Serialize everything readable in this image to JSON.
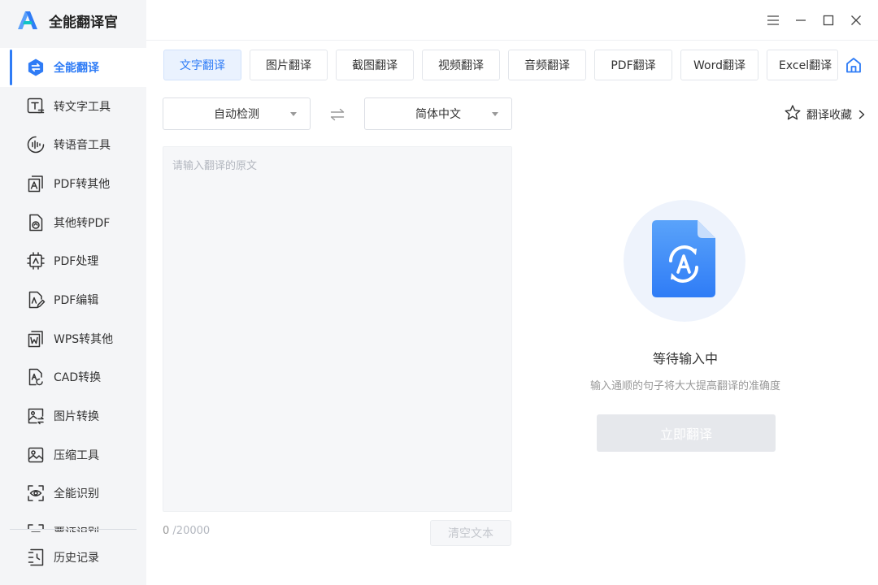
{
  "app": {
    "name": "全能翻译官"
  },
  "sidebar": {
    "items": [
      {
        "label": "全能翻译",
        "icon": "translate-icon",
        "active": true
      },
      {
        "label": "转文字工具",
        "icon": "text-tool-icon"
      },
      {
        "label": "转语音工具",
        "icon": "voice-tool-icon"
      },
      {
        "label": "PDF转其他",
        "icon": "pdf-convert-icon"
      },
      {
        "label": "其他转PDF",
        "icon": "to-pdf-icon"
      },
      {
        "label": "PDF处理",
        "icon": "pdf-process-icon"
      },
      {
        "label": "PDF编辑",
        "icon": "pdf-edit-icon"
      },
      {
        "label": "WPS转其他",
        "icon": "wps-convert-icon"
      },
      {
        "label": "CAD转换",
        "icon": "cad-convert-icon"
      },
      {
        "label": "图片转换",
        "icon": "image-convert-icon"
      },
      {
        "label": "压缩工具",
        "icon": "compress-icon"
      },
      {
        "label": "全能识别",
        "icon": "recognize-icon"
      },
      {
        "label": "票证识别",
        "icon": "ticket-icon"
      }
    ],
    "history_label": "历史记录"
  },
  "tabs": [
    {
      "label": "文字翻译",
      "active": true
    },
    {
      "label": "图片翻译"
    },
    {
      "label": "截图翻译"
    },
    {
      "label": "视频翻译"
    },
    {
      "label": "音频翻译"
    },
    {
      "label": "PDF翻译"
    },
    {
      "label": "Word翻译"
    },
    {
      "label": "Excel翻译"
    }
  ],
  "language": {
    "source": "自动检测",
    "target": "简体中文"
  },
  "favorites_label": "翻译收藏",
  "input": {
    "placeholder": "请输入翻译的原文",
    "char_count": "0",
    "char_limit": "/20000"
  },
  "clear_label": "清空文本",
  "result": {
    "title": "等待输入中",
    "hint": "输入通顺的句子将大大提高翻译的准确度",
    "translate_label": "立即翻译"
  },
  "colors": {
    "accent": "#2f7cf6",
    "sidebar_bg": "#f4f5f7",
    "disabled_btn": "#e6e8ec"
  }
}
